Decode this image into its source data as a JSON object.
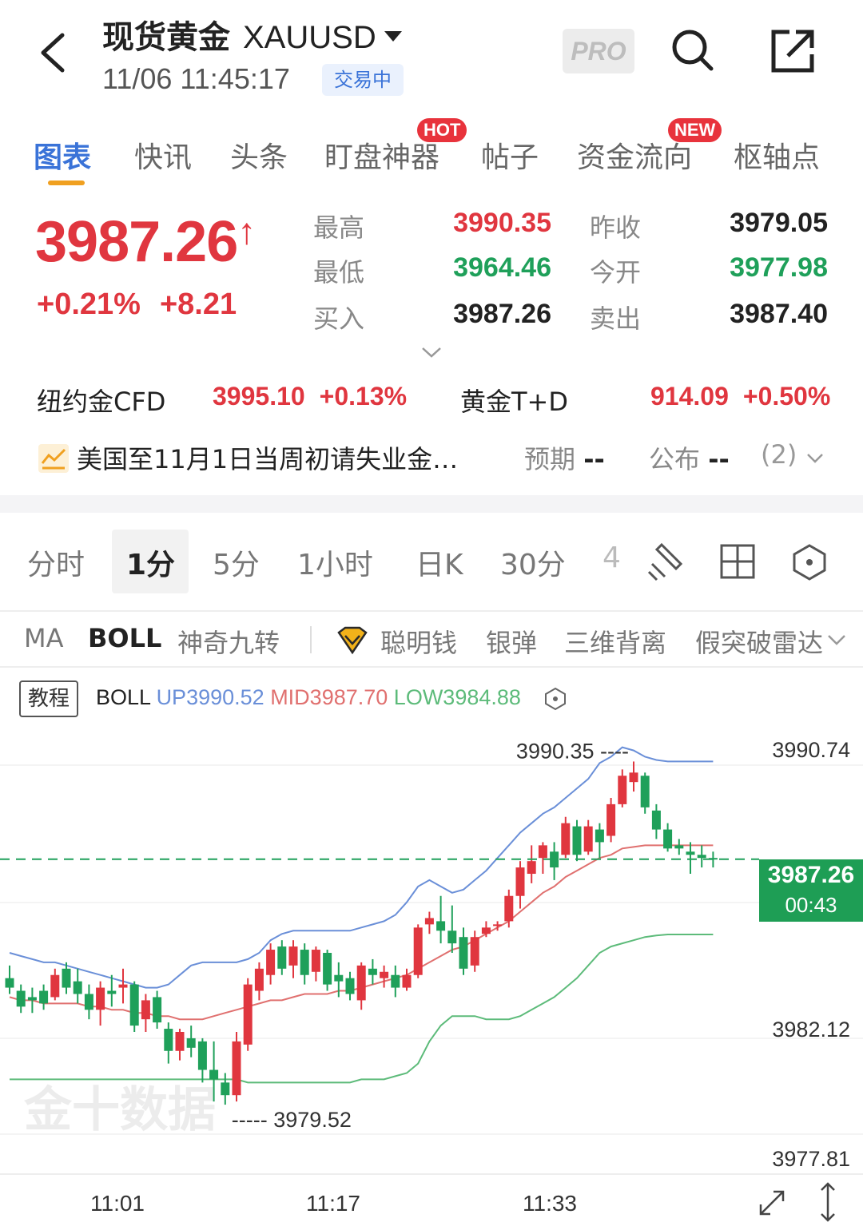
{
  "header": {
    "title": "现货黄金",
    "symbol": "XAUUSD",
    "datetime": "11/06 11:45:17",
    "status": "交易中",
    "pro_label": "PRO"
  },
  "tabs": [
    {
      "label": "图表",
      "active": true
    },
    {
      "label": "快讯"
    },
    {
      "label": "头条"
    },
    {
      "label": "盯盘神器",
      "badge": "HOT"
    },
    {
      "label": "帖子"
    },
    {
      "label": "资金流向",
      "badge": "NEW"
    },
    {
      "label": "枢轴点"
    }
  ],
  "quote": {
    "price": "3987.26",
    "arrow": "↑",
    "change_pct": "+0.21%",
    "change_abs": "+8.21",
    "high_label": "最高",
    "high": "3990.35",
    "low_label": "最低",
    "low": "3964.46",
    "bid_label": "买入",
    "bid": "3987.26",
    "prev_close_label": "昨收",
    "prev_close": "3979.05",
    "open_label": "今开",
    "open": "3977.98",
    "ask_label": "卖出",
    "ask": "3987.40"
  },
  "related": [
    {
      "name": "纽约金CFD",
      "price": "3995.10",
      "change": "+0.13%"
    },
    {
      "name": "黄金T+D",
      "price": "914.09",
      "change": "+0.50%"
    }
  ],
  "news": {
    "title": "美国至11月1日当周初请失业金…",
    "expected_label": "预期",
    "expected": "--",
    "actual_label": "公布",
    "actual": "--",
    "count": "(2)"
  },
  "periods": [
    {
      "label": "分时"
    },
    {
      "label": "1分",
      "active": true
    },
    {
      "label": "5分"
    },
    {
      "label": "1小时"
    },
    {
      "label": "日K"
    },
    {
      "label": "30分"
    },
    {
      "label": "4"
    }
  ],
  "indicators": [
    {
      "label": "MA"
    },
    {
      "label": "BOLL",
      "active": true
    },
    {
      "label": "神奇九转"
    },
    {
      "label": "聪明钱"
    },
    {
      "label": "银弹"
    },
    {
      "label": "三维背离"
    },
    {
      "label": "假突破雷达"
    }
  ],
  "boll": {
    "tutorial": "教程",
    "name": "BOLL",
    "up": "UP3990.52",
    "mid": "MID3987.70",
    "low": "LOW3984.88"
  },
  "colors": {
    "up": "#e0363f",
    "down": "#1fa05a",
    "accent": "#3a73d8",
    "boll_up": "#6a8fd8",
    "boll_mid": "#e0706f",
    "boll_low": "#5dbb7a"
  },
  "chart_data": {
    "type": "candlestick",
    "y_ticks": [
      "3990.74",
      "3982.12",
      "3977.81"
    ],
    "x_ticks": [
      "11:01",
      "11:17",
      "11:33"
    ],
    "ylim": [
      3977.81,
      3990.74
    ],
    "high_label": "3990.35",
    "low_label": "3979.52",
    "last_price": "3987.26",
    "countdown": "00:43",
    "watermark": "金十数据",
    "candles": [
      [
        3983.5,
        3983.9,
        3983.0,
        3983.2
      ],
      [
        3983.1,
        3983.3,
        3982.4,
        3982.6
      ],
      [
        3982.9,
        3983.2,
        3982.4,
        3982.8
      ],
      [
        3983.1,
        3983.3,
        3982.5,
        3982.7
      ],
      [
        3982.9,
        3983.8,
        3982.8,
        3983.6
      ],
      [
        3983.8,
        3984.0,
        3983.0,
        3983.2
      ],
      [
        3983.4,
        3983.8,
        3982.7,
        3983.0
      ],
      [
        3983.0,
        3983.3,
        3982.2,
        3982.5
      ],
      [
        3982.5,
        3983.4,
        3982.0,
        3983.2
      ],
      [
        3983.1,
        3983.6,
        3982.6,
        3983.0
      ],
      [
        3983.2,
        3983.8,
        3982.7,
        3983.3
      ],
      [
        3983.3,
        3983.4,
        3981.8,
        3982.0
      ],
      [
        3982.2,
        3983.0,
        3981.8,
        3982.8
      ],
      [
        3982.9,
        3983.1,
        3981.9,
        3982.1
      ],
      [
        3981.9,
        3982.1,
        3980.8,
        3981.2
      ],
      [
        3981.2,
        3981.9,
        3980.9,
        3981.8
      ],
      [
        3981.6,
        3982.0,
        3981.0,
        3981.3
      ],
      [
        3981.5,
        3981.6,
        3980.2,
        3980.6
      ],
      [
        3980.6,
        3981.5,
        3979.6,
        3980.3
      ],
      [
        3980.2,
        3980.5,
        3979.5,
        3979.8
      ],
      [
        3979.8,
        3981.8,
        3979.6,
        3981.5
      ],
      [
        3981.4,
        3983.5,
        3981.2,
        3983.3
      ],
      [
        3983.1,
        3984.0,
        3982.8,
        3983.8
      ],
      [
        3983.6,
        3984.6,
        3983.3,
        3984.4
      ],
      [
        3984.5,
        3984.7,
        3983.6,
        3983.8
      ],
      [
        3983.9,
        3984.7,
        3983.5,
        3984.5
      ],
      [
        3984.4,
        3984.6,
        3983.3,
        3983.6
      ],
      [
        3983.7,
        3984.5,
        3983.4,
        3984.4
      ],
      [
        3984.3,
        3984.4,
        3983.1,
        3983.3
      ],
      [
        3983.6,
        3984.0,
        3982.9,
        3983.4
      ],
      [
        3983.5,
        3983.7,
        3982.8,
        3983.0
      ],
      [
        3982.8,
        3984.0,
        3982.5,
        3983.9
      ],
      [
        3983.8,
        3984.1,
        3983.3,
        3983.6
      ],
      [
        3983.5,
        3983.9,
        3983.2,
        3983.7
      ],
      [
        3983.6,
        3983.9,
        3982.9,
        3983.2
      ],
      [
        3983.2,
        3983.8,
        3983.1,
        3983.6
      ],
      [
        3983.6,
        3985.2,
        3983.5,
        3985.1
      ],
      [
        3985.2,
        3985.6,
        3984.9,
        3985.4
      ],
      [
        3985.3,
        3986.1,
        3984.6,
        3985.0
      ],
      [
        3985.0,
        3985.8,
        3984.3,
        3984.6
      ],
      [
        3984.8,
        3985.1,
        3983.6,
        3983.8
      ],
      [
        3983.9,
        3985.0,
        3983.7,
        3984.8
      ],
      [
        3984.9,
        3985.3,
        3984.8,
        3985.1
      ],
      [
        3985.2,
        3985.3,
        3985.0,
        3985.2
      ],
      [
        3985.3,
        3986.3,
        3985.1,
        3986.1
      ],
      [
        3986.1,
        3987.2,
        3985.7,
        3987.0
      ],
      [
        3986.8,
        3987.7,
        3986.5,
        3987.2
      ],
      [
        3987.3,
        3987.8,
        3986.8,
        3987.7
      ],
      [
        3987.5,
        3987.8,
        3986.6,
        3987.0
      ],
      [
        3987.4,
        3988.6,
        3987.3,
        3988.4
      ],
      [
        3988.3,
        3988.5,
        3987.2,
        3987.4
      ],
      [
        3987.5,
        3988.5,
        3987.4,
        3988.3
      ],
      [
        3988.2,
        3988.4,
        3987.3,
        3987.8
      ],
      [
        3988.0,
        3989.2,
        3987.8,
        3989.0
      ],
      [
        3989.0,
        3990.1,
        3988.9,
        3989.9
      ],
      [
        3989.7,
        3990.35,
        3989.4,
        3990.0
      ],
      [
        3989.9,
        3990.0,
        3988.7,
        3988.9
      ],
      [
        3988.8,
        3989.0,
        3987.9,
        3988.2
      ],
      [
        3988.2,
        3988.4,
        3987.5,
        3987.6
      ],
      [
        3987.7,
        3987.9,
        3987.4,
        3987.6
      ],
      [
        3987.5,
        3987.8,
        3986.8,
        3987.4
      ],
      [
        3987.4,
        3987.7,
        3987.0,
        3987.3
      ],
      [
        3987.3,
        3987.5,
        3987.0,
        3987.26
      ]
    ],
    "boll_up": [
      3984.3,
      3984.2,
      3984.1,
      3984.0,
      3984.0,
      3983.9,
      3983.8,
      3983.7,
      3983.6,
      3983.5,
      3983.4,
      3983.3,
      3983.2,
      3983.2,
      3983.3,
      3983.6,
      3983.9,
      3984.0,
      3984.0,
      3984.0,
      3984.0,
      3984.1,
      3984.3,
      3984.7,
      3984.9,
      3985.0,
      3985.0,
      3985.0,
      3985.0,
      3985.0,
      3985.0,
      3985.1,
      3985.2,
      3985.3,
      3985.5,
      3985.9,
      3986.4,
      3986.6,
      3986.4,
      3986.2,
      3986.3,
      3986.6,
      3986.9,
      3987.3,
      3987.7,
      3988.1,
      3988.4,
      3988.7,
      3988.9,
      3989.2,
      3989.5,
      3989.8,
      3990.3,
      3990.5,
      3990.8,
      3990.7,
      3990.5,
      3990.4,
      3990.35,
      3990.35,
      3990.35,
      3990.35,
      3990.35
    ],
    "boll_mid": [
      3982.9,
      3982.8,
      3982.8,
      3982.7,
      3982.7,
      3982.7,
      3982.7,
      3982.6,
      3982.6,
      3982.5,
      3982.5,
      3982.4,
      3982.4,
      3982.3,
      3982.3,
      3982.2,
      3982.2,
      3982.2,
      3982.3,
      3982.4,
      3982.5,
      3982.6,
      3982.7,
      3982.8,
      3982.8,
      3982.9,
      3983.0,
      3983.0,
      3983.0,
      3983.1,
      3983.1,
      3983.2,
      3983.3,
      3983.4,
      3983.5,
      3983.6,
      3983.8,
      3984.0,
      3984.2,
      3984.4,
      3984.5,
      3984.7,
      3984.9,
      3985.1,
      3985.3,
      3985.6,
      3985.9,
      3986.2,
      3986.4,
      3986.7,
      3986.9,
      3987.1,
      3987.3,
      3987.4,
      3987.6,
      3987.65,
      3987.7,
      3987.7,
      3987.7,
      3987.7,
      3987.7,
      3987.7,
      3987.7
    ],
    "boll_low": [
      3980.3,
      3980.3,
      3980.3,
      3980.3,
      3980.3,
      3980.3,
      3980.3,
      3980.3,
      3980.3,
      3980.3,
      3980.3,
      3980.3,
      3980.3,
      3980.3,
      3980.3,
      3980.3,
      3980.3,
      3980.3,
      3980.3,
      3980.3,
      3980.3,
      3980.2,
      3980.2,
      3980.2,
      3980.2,
      3980.2,
      3980.2,
      3980.2,
      3980.2,
      3980.2,
      3980.2,
      3980.3,
      3980.3,
      3980.3,
      3980.4,
      3980.5,
      3980.8,
      3981.5,
      3982.0,
      3982.3,
      3982.3,
      3982.3,
      3982.2,
      3982.2,
      3982.2,
      3982.3,
      3982.5,
      3982.7,
      3982.9,
      3983.2,
      3983.5,
      3983.9,
      3984.3,
      3984.5,
      3984.6,
      3984.7,
      3984.8,
      3984.85,
      3984.88,
      3984.88,
      3984.88,
      3984.88,
      3984.88
    ]
  }
}
